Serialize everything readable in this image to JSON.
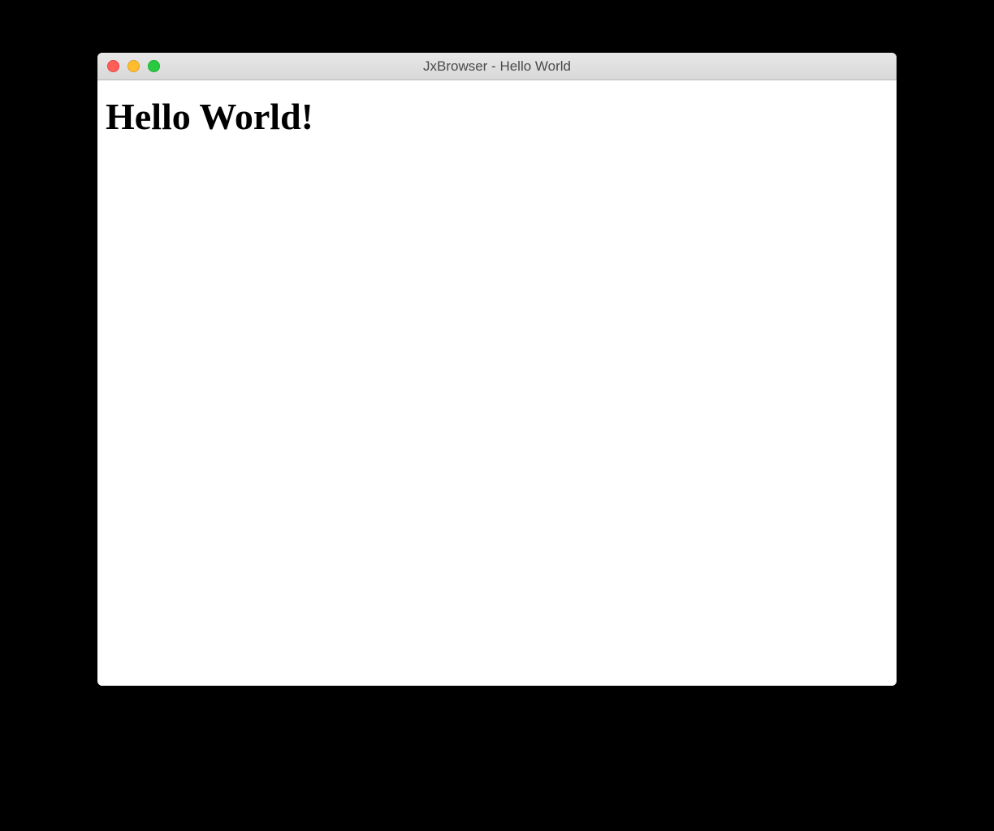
{
  "window": {
    "title": "JxBrowser - Hello World"
  },
  "content": {
    "heading": "Hello World!"
  }
}
